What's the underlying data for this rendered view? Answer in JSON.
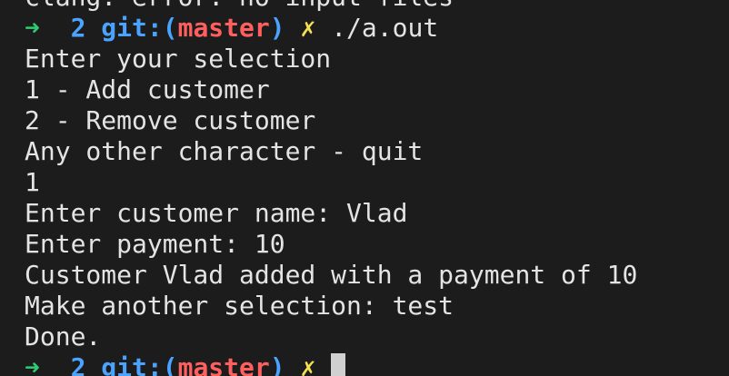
{
  "colors": {
    "background": "#1c1c1c",
    "text": "#e4e4e4",
    "arrow": "#2ecc71",
    "git": "#4aa3ff",
    "branch": "#ff5f5f",
    "dirty_marker": "#f5e050"
  },
  "prompt": {
    "arrow": "➜",
    "count": "2",
    "git_prefix": "git:",
    "open_paren": "(",
    "branch": "master",
    "close_paren": ")",
    "dirty_marker": "✗"
  },
  "top_partial_line": "clang: error: no input files",
  "command": "./a.out",
  "output_lines": [
    "Enter your selection",
    "1 - Add customer",
    "2 - Remove customer",
    "Any other character - quit",
    "1",
    "Enter customer name: Vlad",
    "Enter payment: 10",
    "Customer Vlad added with a payment of 10",
    "Make another selection: test",
    "Done."
  ]
}
